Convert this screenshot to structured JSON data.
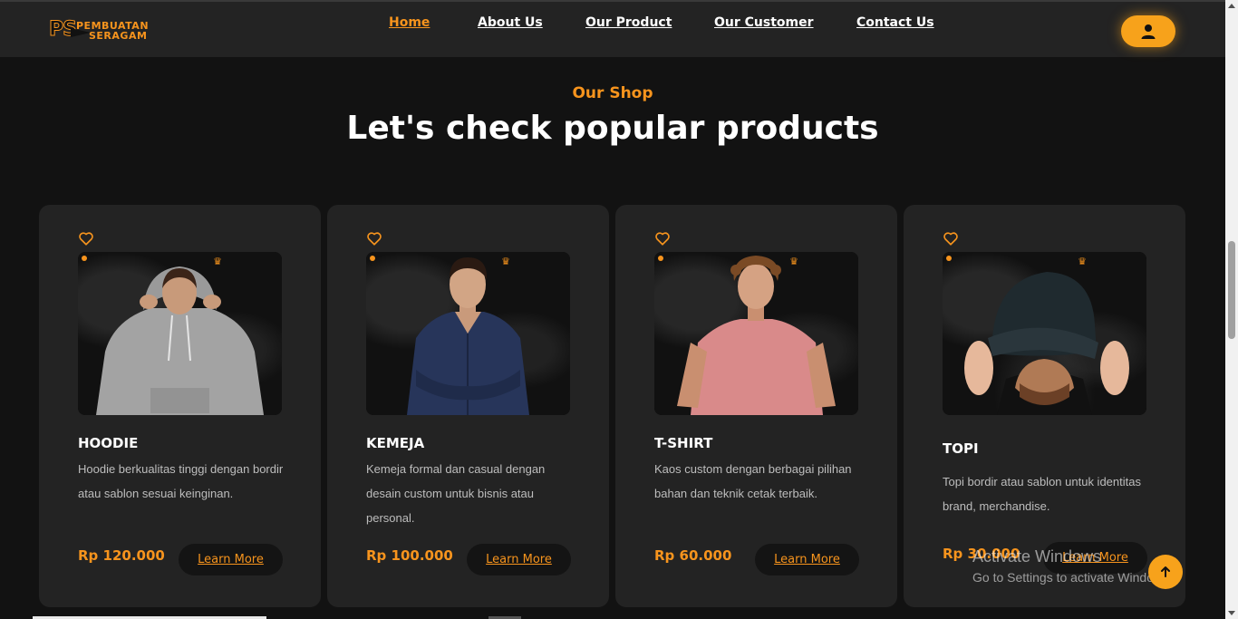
{
  "brand": {
    "logo_mark": "PS",
    "logo_line1": "PEMBUATAN",
    "logo_line2": "SERAGAM"
  },
  "nav": {
    "items": [
      {
        "label": "Home",
        "active": true
      },
      {
        "label": "About Us",
        "active": false
      },
      {
        "label": "Our Product",
        "active": false
      },
      {
        "label": "Our Customer",
        "active": false
      },
      {
        "label": "Contact Us",
        "active": false
      }
    ],
    "user_icon": "user-icon"
  },
  "section": {
    "eyebrow": "Our Shop",
    "heading": "Let's check popular products"
  },
  "products": [
    {
      "name": "HOODIE",
      "description": "Hoodie berkualitas tinggi dengan bordir atau sablon sesuai keinginan.",
      "price": "Rp 120.000",
      "cta": "Learn More",
      "image_subject": "grey-hoodie-model"
    },
    {
      "name": "KEMEJA",
      "description": "Kemeja formal dan casual dengan desain custom untuk bisnis atau personal.",
      "price": "Rp 100.000",
      "cta": "Learn More",
      "image_subject": "navy-shirt-model"
    },
    {
      "name": "T-SHIRT",
      "description": "Kaos custom dengan berbagai pilihan bahan dan teknik cetak terbaik.",
      "price": "Rp 60.000",
      "cta": "Learn More",
      "image_subject": "pink-tshirt-model"
    },
    {
      "name": "TOPI",
      "description": "Topi bordir atau sablon untuk identitas brand, merchandise.",
      "price": "Rp 30.000",
      "cta": "Learn More",
      "image_subject": "black-cap-model"
    }
  ],
  "watermark": {
    "line1": "Activate Windows",
    "line2": "Go to Settings to activate Windows."
  },
  "colors": {
    "accent": "#f7941d",
    "background": "#121212",
    "card": "#232323",
    "navbar": "#232323"
  },
  "icons": {
    "heart": "heart-outline-icon",
    "to_top": "arrow-up-icon"
  }
}
